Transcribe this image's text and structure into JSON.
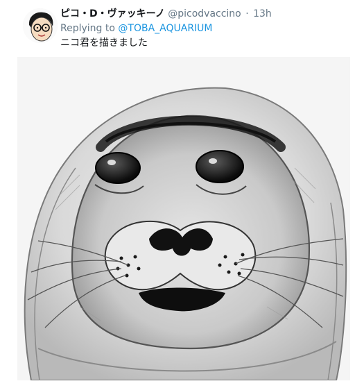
{
  "tweet": {
    "display_name": "ピコ・D・ヴァッキーノ",
    "handle": "@picodvaccino",
    "separator": "·",
    "time": "13h",
    "reply_prefix": "Replying to",
    "reply_target": "@TOBA_AQUARIUM",
    "text": "ニコ君を描きました"
  },
  "avatar": {
    "icon": "cartoon-face-with-glasses-icon"
  },
  "media": {
    "subject": "pencil-sketch-seal-icon"
  }
}
